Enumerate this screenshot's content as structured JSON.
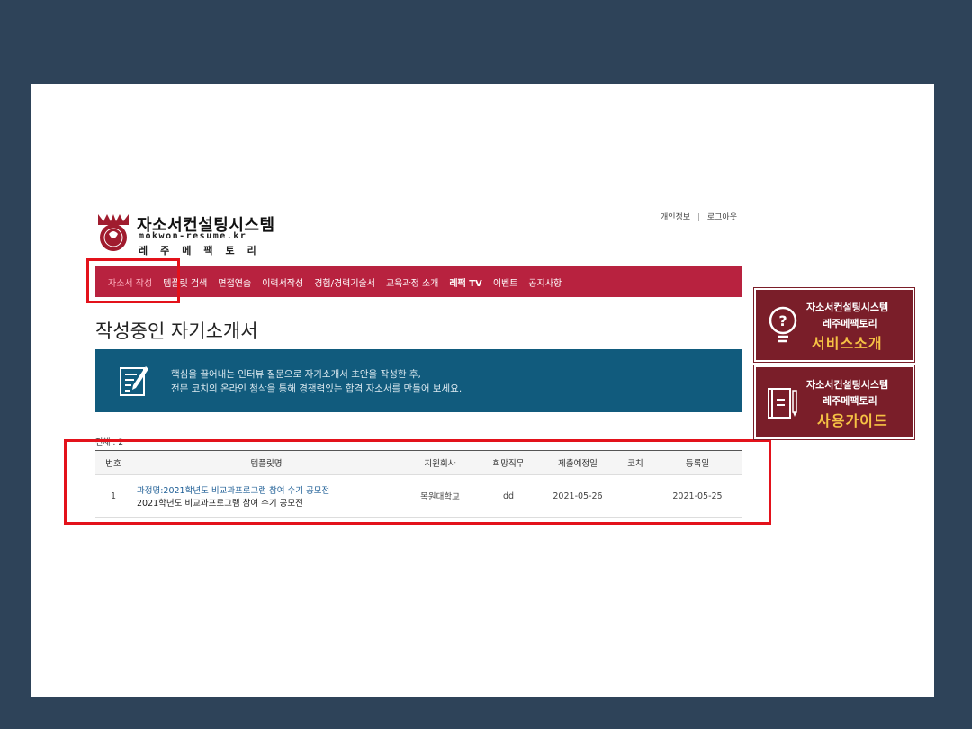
{
  "header": {
    "logo_title": "자소서컨설팅시스템",
    "logo_domain": "mokwon-resume.kr",
    "logo_subtitle": "레주메팩토리",
    "links": [
      "개인정보",
      "로그아웃"
    ]
  },
  "nav": {
    "items": [
      "자소서 작성",
      "템플릿 검색",
      "면접연습",
      "이력서작성",
      "경험/경력기술서",
      "교육과정 소개",
      "레팩 TV",
      "이벤트",
      "공지사항"
    ],
    "active_index": 0
  },
  "page": {
    "title": "작성중인 자기소개서"
  },
  "banner": {
    "line1": "핵심을 끌어내는 인터뷰 질문으로 자기소개서 초안을 작성한 후,",
    "line2": "전문 코치의 온라인 첨삭을 통해 경쟁력있는 합격 자소서를 만들어 보세요."
  },
  "table": {
    "total": "전체 : 2",
    "headers": [
      "번호",
      "템플릿명",
      "지원회사",
      "희망직무",
      "제출예정일",
      "코치",
      "등록일"
    ],
    "rows": [
      {
        "no": "1",
        "course": "과정명:2021학년도 비교과프로그램 참여 수기 공모전",
        "template": "2021학년도 비교과프로그램 참여 수기 공모전",
        "company": "목원대학교",
        "job": "dd",
        "due": "2021-05-26",
        "coach": "",
        "registered": "2021-05-25"
      }
    ]
  },
  "side_banners": [
    {
      "line1": "자소서컨설팅시스템",
      "line2": "레주메팩토리",
      "line3": "서비스소개",
      "icon": "lightbulb-question-icon"
    },
    {
      "line1": "자소서컨설팅시스템",
      "line2": "레주메팩토리",
      "line3": "사용가이드",
      "icon": "book-pen-icon"
    }
  ],
  "colors": {
    "background": "#2e4359",
    "nav": "#b8223f",
    "banner": "#115b7d",
    "side_banner": "#7a1e29",
    "highlight": "#e3121b",
    "accent_text": "#f6c244"
  }
}
